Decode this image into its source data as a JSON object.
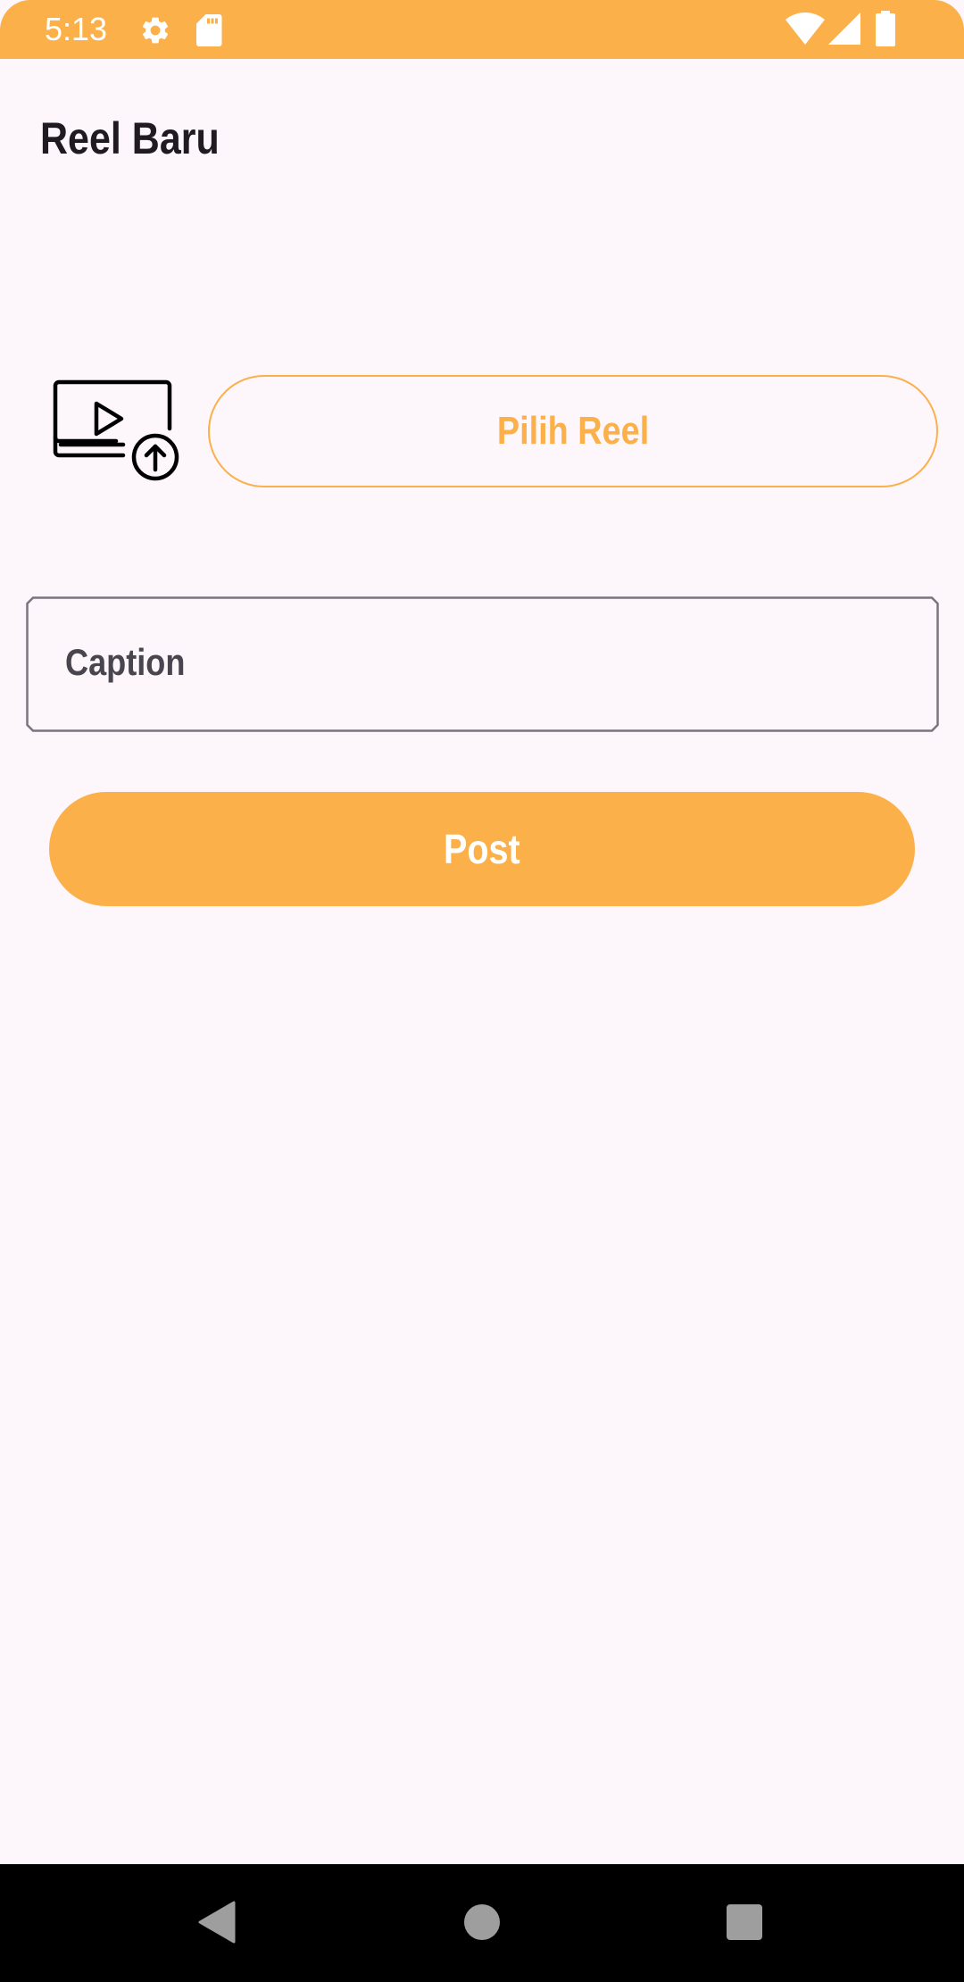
{
  "status_bar": {
    "time": "5:13",
    "icons": [
      "settings-icon",
      "sd-card-icon",
      "wifi-icon",
      "cell-signal-icon",
      "battery-icon"
    ],
    "background": "#fbb04a"
  },
  "page": {
    "title": "Reel Baru"
  },
  "upload": {
    "icon": "video-upload-icon",
    "pick_button_label": "Pilih Reel"
  },
  "caption": {
    "placeholder": "Caption",
    "value": ""
  },
  "post_button_label": "Post",
  "navigation": {
    "items": [
      "back-icon",
      "home-icon",
      "recents-icon"
    ]
  },
  "colors": {
    "accent": "#fbb04a",
    "background": "#fdf6fb",
    "text_primary": "#1f1b20",
    "outline": "#79747e"
  }
}
